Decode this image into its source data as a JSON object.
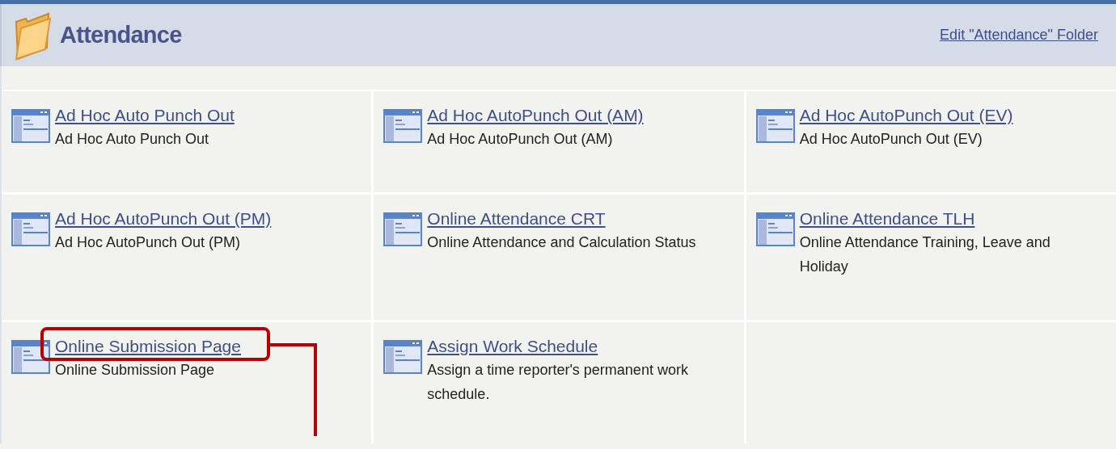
{
  "header": {
    "title": "Attendance",
    "edit_link": "Edit \"Attendance\" Folder"
  },
  "items": [
    {
      "title": "Ad Hoc Auto Punch Out",
      "description": "Ad Hoc Auto Punch Out",
      "highlighted": false
    },
    {
      "title": "Ad Hoc AutoPunch Out (AM)",
      "description": "Ad Hoc AutoPunch Out (AM)",
      "highlighted": false
    },
    {
      "title": "Ad Hoc AutoPunch Out (EV)",
      "description": "Ad Hoc AutoPunch Out (EV)",
      "highlighted": false
    },
    {
      "title": "Ad Hoc AutoPunch Out (PM)",
      "description": "Ad Hoc AutoPunch Out (PM)",
      "highlighted": false
    },
    {
      "title": "Online Attendance CRT",
      "description": "Online Attendance and Calculation Status",
      "highlighted": false
    },
    {
      "title": "Online Attendance TLH",
      "description": "Online Attendance Training, Leave and Holiday",
      "highlighted": false
    },
    {
      "title": "Online Submission Page",
      "description": "Online Submission Page",
      "highlighted": true
    },
    {
      "title": "Assign Work Schedule",
      "description": "Assign a time reporter's permanent work schedule.",
      "highlighted": false
    }
  ]
}
